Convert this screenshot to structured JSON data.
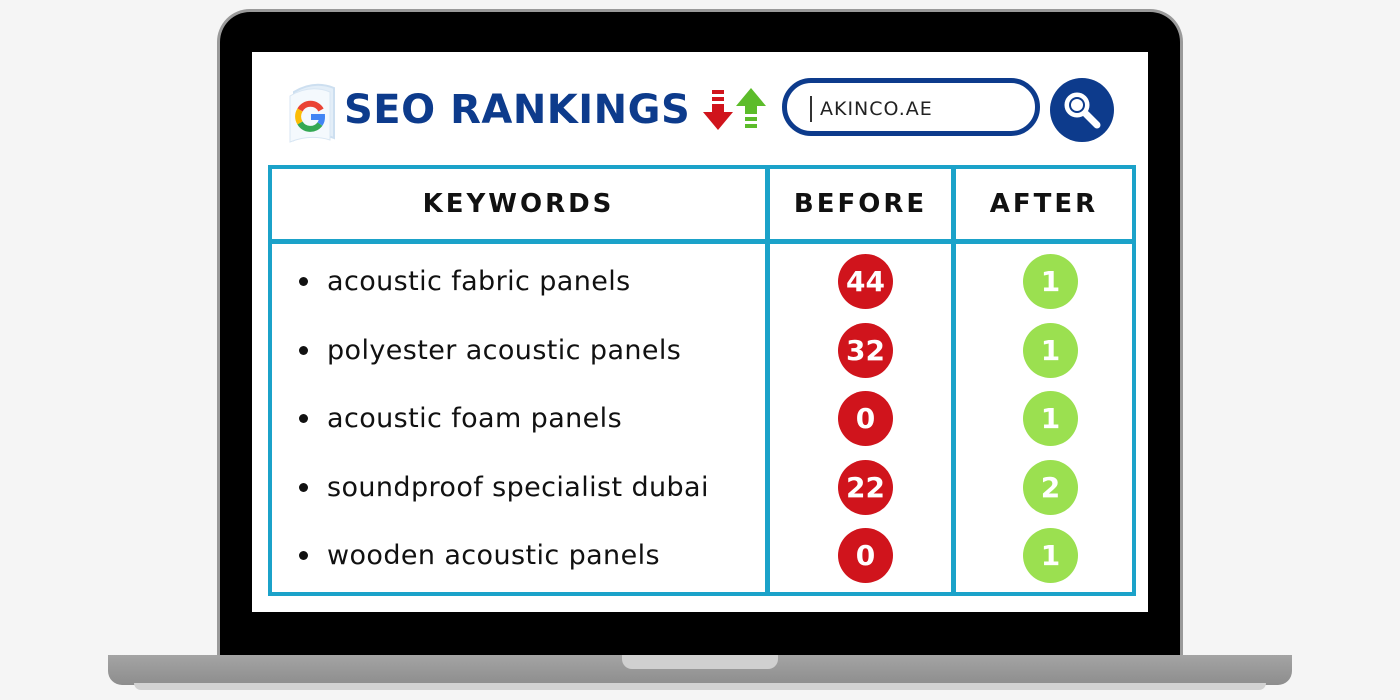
{
  "header": {
    "title": "SEO RANKINGS",
    "google_icon": "google-g-icon",
    "trend_icon": "down-up-arrows-icon"
  },
  "search": {
    "value": "AKINCO.AE",
    "button_icon": "magnifier-icon"
  },
  "table": {
    "headers": {
      "keywords": "KEYWORDS",
      "before": "BEFORE",
      "after": "AFTER"
    },
    "rows": [
      {
        "keyword": "acoustic fabric panels",
        "before": "44",
        "after": "1"
      },
      {
        "keyword": "polyester acoustic panels",
        "before": "32",
        "after": "1"
      },
      {
        "keyword": "acoustic foam panels",
        "before": "0",
        "after": "1"
      },
      {
        "keyword": "soundproof specialist dubai",
        "before": "22",
        "after": "2"
      },
      {
        "keyword": "wooden acoustic panels",
        "before": "0",
        "after": "1"
      }
    ]
  },
  "colors": {
    "brand_navy": "#0d3b8c",
    "table_border": "#1ba2c9",
    "before_badge": "#d0141c",
    "after_badge": "#9be050"
  }
}
